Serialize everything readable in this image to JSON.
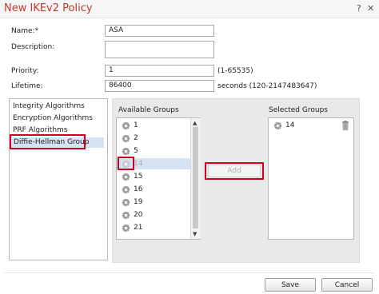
{
  "dialog": {
    "title": "New IKEv2 Policy",
    "help_icon": "help-icon",
    "close_icon": "close-icon"
  },
  "form": {
    "name_label": "Name:*",
    "name_value": "ASA",
    "description_label": "Description:",
    "description_value": "",
    "priority_label": "Priority:",
    "priority_value": "1",
    "priority_hint": "(1-65535)",
    "lifetime_label": "Lifetime:",
    "lifetime_value": "86400",
    "lifetime_hint": "seconds (120-2147483647)"
  },
  "nav": {
    "items": [
      {
        "label": "Integrity Algorithms"
      },
      {
        "label": "Encryption Algorithms"
      },
      {
        "label": "PRF Algorithms"
      },
      {
        "label": "Diffie-Hellman Group"
      }
    ],
    "selected_index": 3
  },
  "groups": {
    "available_label": "Available Groups",
    "selected_label": "Selected Groups",
    "available": [
      "1",
      "2",
      "5",
      "14",
      "15",
      "16",
      "19",
      "20",
      "21"
    ],
    "available_selected": "14",
    "selected": [
      "14"
    ],
    "add_label": "Add",
    "item_icon": "gear-icon",
    "remove_icon": "trash-icon"
  },
  "footer": {
    "save_label": "Save",
    "cancel_label": "Cancel"
  },
  "colors": {
    "title": "#c0392b",
    "highlight": "#d1001f",
    "selection": "#d5e3f5"
  }
}
